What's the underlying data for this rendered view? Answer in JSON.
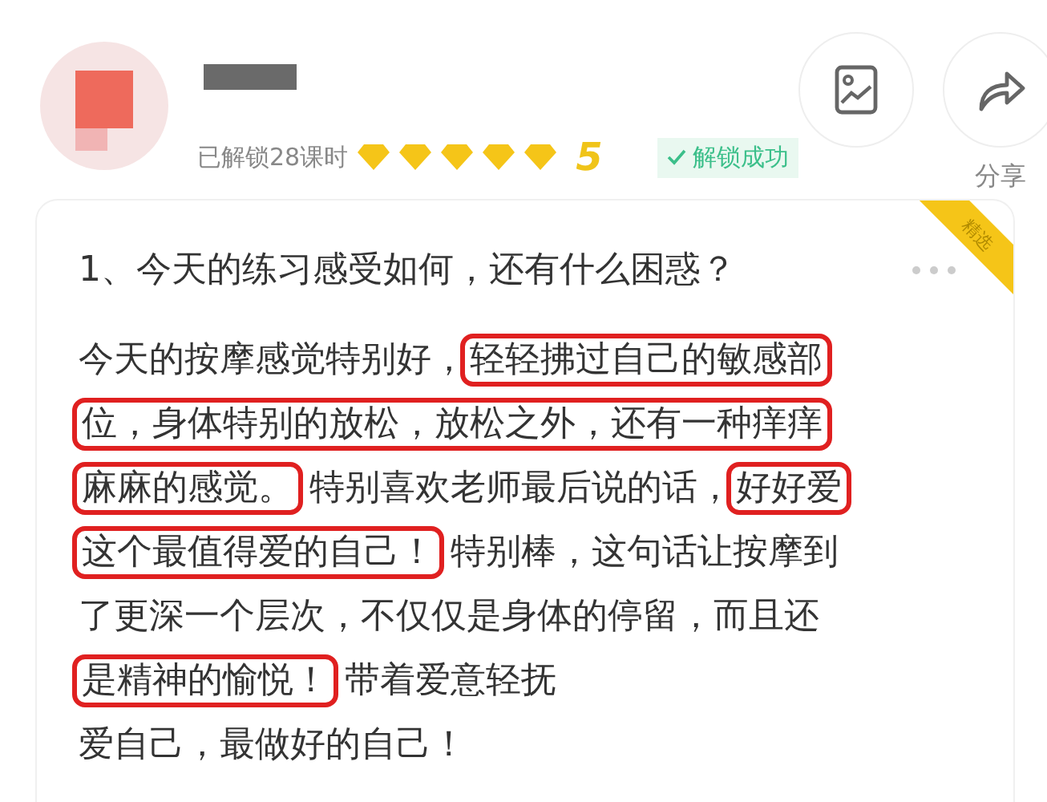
{
  "user": {
    "unlocked": "已解锁28课时",
    "stars": 5,
    "level_number": "5",
    "badge": "解锁成功"
  },
  "actions": [
    {
      "kind": "image"
    },
    {
      "kind": "share",
      "label": "分享"
    }
  ],
  "post": {
    "tag": "精选",
    "question": "1、今天的练习感受如何，还有什么困惑？",
    "lines": [
      [
        {
          "text": "今天的按摩感觉特别好，",
          "highlighted": false
        },
        {
          "text": "轻轻拂过自己的敏感部",
          "highlighted": true
        }
      ],
      [
        {
          "text": "位，身体特别的放松，放松之外，还有一种痒痒",
          "highlighted": true
        }
      ],
      [
        {
          "text": "麻麻的感觉。",
          "highlighted": true
        },
        {
          "text": "特别喜欢老师最后说的话，",
          "highlighted": false
        },
        {
          "text": "好好爱",
          "highlighted": true
        }
      ],
      [
        {
          "text": "这个最值得爱的自己！",
          "highlighted": true
        },
        {
          "text": "特别棒，这句话让按摩到",
          "highlighted": false
        }
      ],
      [
        {
          "text": "了更深一个层次，不仅仅是身体的停留，而且还",
          "highlighted": false
        }
      ],
      [
        {
          "text": "是精神的愉悦！",
          "highlighted": true
        },
        {
          "text": "带着爱意轻抚",
          "highlighted": false
        }
      ],
      [
        {
          "text": "爱自己，最做好的自己！",
          "highlighted": false
        }
      ]
    ]
  }
}
